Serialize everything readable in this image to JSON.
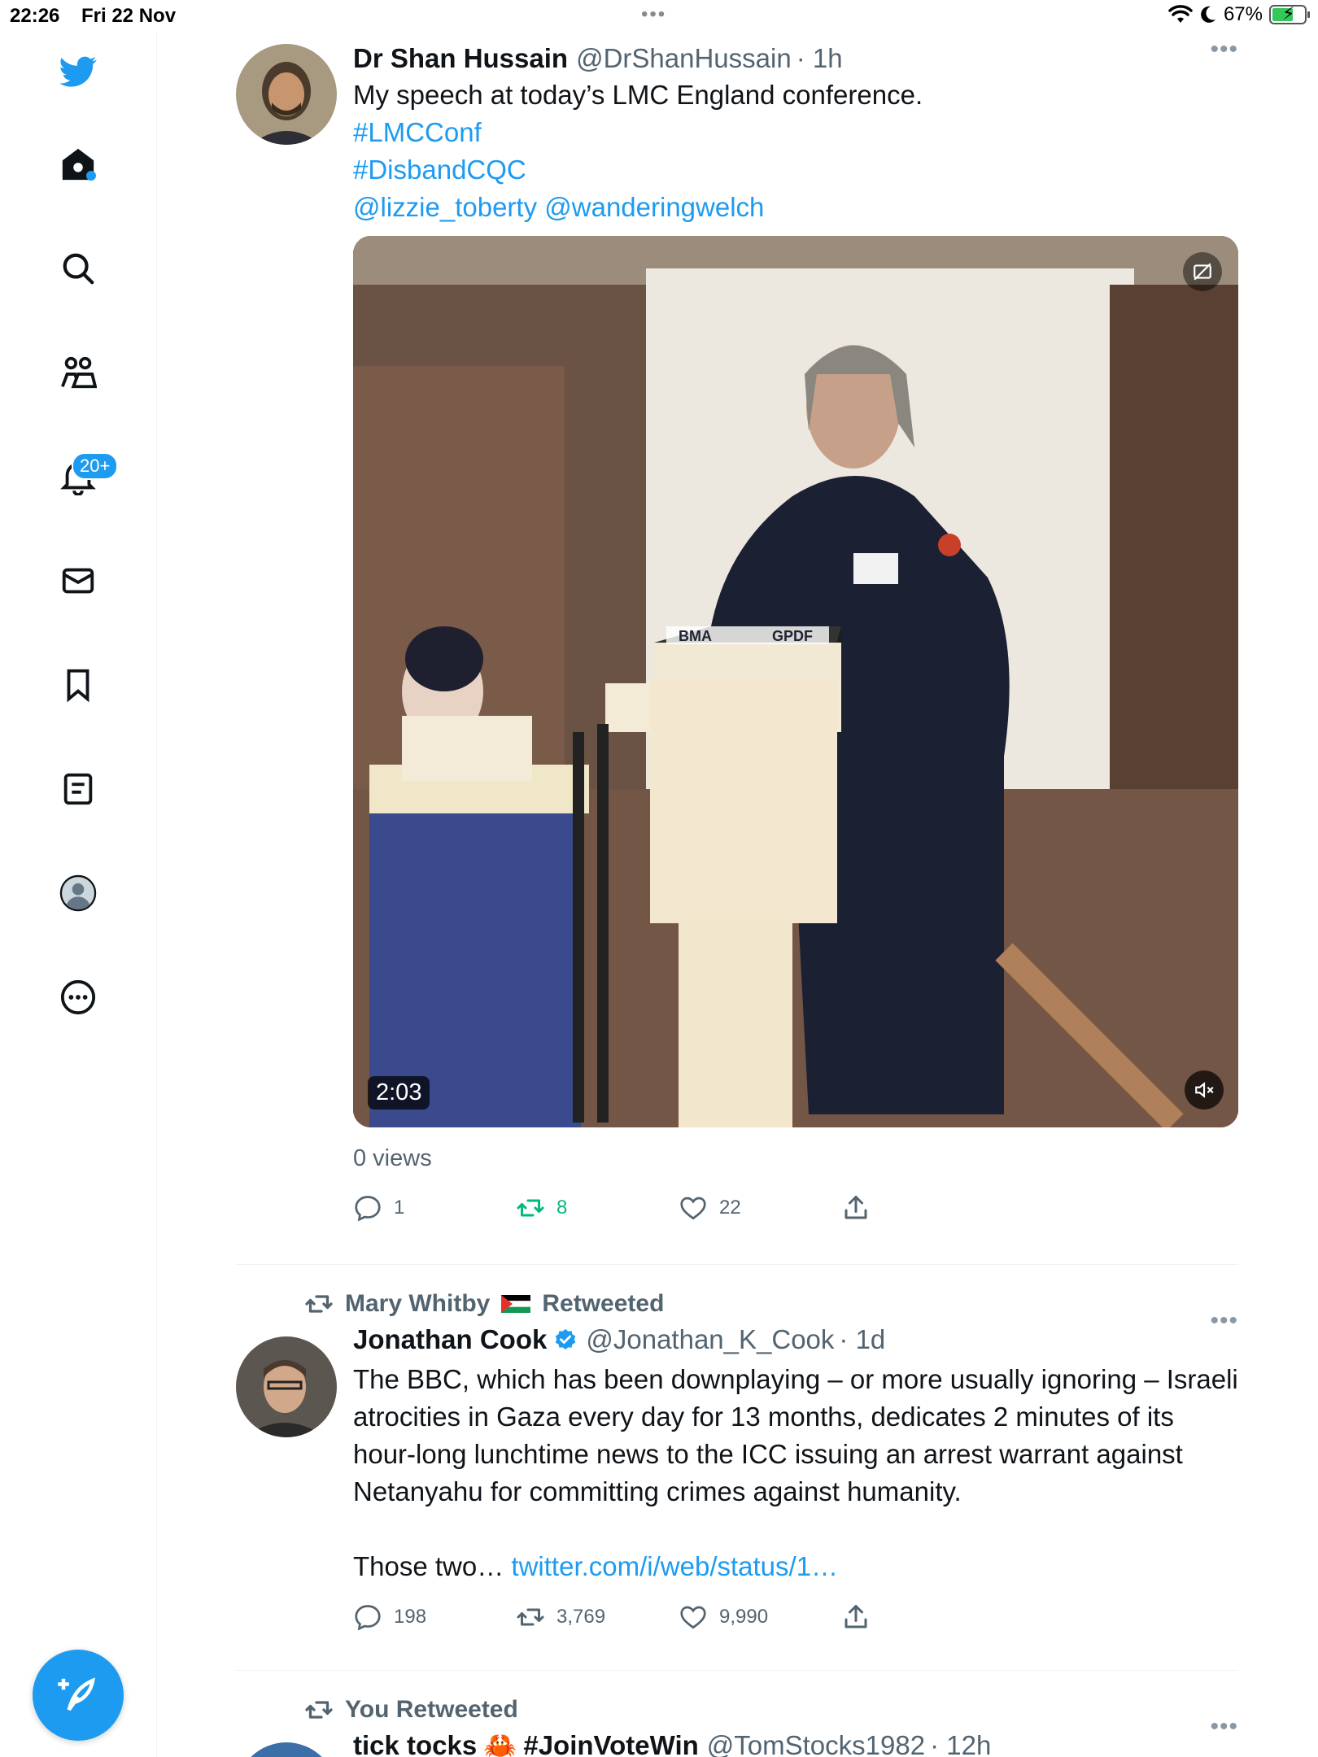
{
  "status_bar": {
    "time": "22:26",
    "date": "Fri 22 Nov",
    "multitask_dots": "•••",
    "battery_percent": "67%",
    "battery_level": 0.67,
    "icons": [
      "wifi-icon",
      "moon-icon",
      "battery-charging-icon"
    ]
  },
  "sidebar": {
    "items": [
      {
        "icon": "twitter-bird-icon"
      },
      {
        "icon": "home-icon"
      },
      {
        "icon": "search-icon"
      },
      {
        "icon": "communities-icon"
      },
      {
        "icon": "notifications-icon",
        "badge": "20+"
      },
      {
        "icon": "messages-icon"
      },
      {
        "icon": "bookmarks-icon"
      },
      {
        "icon": "lists-icon"
      },
      {
        "icon": "profile-icon"
      },
      {
        "icon": "more-circle-icon"
      }
    ],
    "compose_icon": "compose-feather-icon"
  },
  "colors": {
    "accent": "#1d9bf0",
    "retweet_active": "#00ba7c",
    "muted_text": "#536471"
  },
  "tweets": [
    {
      "name": "Dr Shan Hussain",
      "handle": "@DrShanHussain",
      "time": "· 1h",
      "text": "My speech at today’s LMC England conference.",
      "hashtags": [
        "#LMCConf",
        "#DisbandCQC"
      ],
      "mentions": "@lizzie_toberty @wanderingwelch",
      "media": {
        "duration": "2:03",
        "podium_logo_left": "BMA",
        "podium_logo_right": "GPDF"
      },
      "views": "0 views",
      "replies": "1",
      "retweets": "8",
      "likes": "22"
    },
    {
      "social_context_name": "Mary Whitby",
      "social_context_suffix": "Retweeted",
      "name": "Jonathan Cook",
      "handle": "@Jonathan_K_Cook",
      "time": "· 1d",
      "text": "The BBC, which has been downplaying – or more usually ignoring – Israeli atrocities in Gaza every day for 13 months, dedicates 2 minutes of its hour-long lunchtime news to the ICC issuing an arrest warrant against Netanyahu for committing crimes against humanity.",
      "text_more": "Those two…",
      "link": "twitter.com/i/web/status/1…",
      "replies": "198",
      "retweets": "3,769",
      "likes": "9,990"
    },
    {
      "social_context": "You Retweeted",
      "name": "tick tocks",
      "name_suffix": "#JoinVoteWin",
      "handle": "@TomStocks1982",
      "time": "· 12h"
    }
  ],
  "more_label": "•••"
}
